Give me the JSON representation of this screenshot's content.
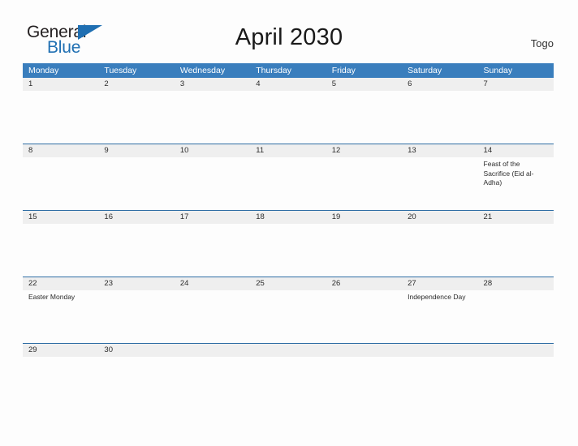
{
  "logo": {
    "word1": "General",
    "word2": "Blue",
    "triangle_color": "#1f6fb2"
  },
  "header": {
    "title": "April 2030",
    "country": "Togo"
  },
  "theme": {
    "header_blue": "#3a7ebd",
    "rule_blue": "#2e6da4",
    "date_band": "#efefef",
    "page_background": "#fdfdfd",
    "text": "#2b2b2b"
  },
  "calendar": {
    "weekdays": [
      "Monday",
      "Tuesday",
      "Wednesday",
      "Thursday",
      "Friday",
      "Saturday",
      "Sunday"
    ],
    "weeks": [
      {
        "days": [
          {
            "date": "1",
            "event": ""
          },
          {
            "date": "2",
            "event": ""
          },
          {
            "date": "3",
            "event": ""
          },
          {
            "date": "4",
            "event": ""
          },
          {
            "date": "5",
            "event": ""
          },
          {
            "date": "6",
            "event": ""
          },
          {
            "date": "7",
            "event": ""
          }
        ]
      },
      {
        "days": [
          {
            "date": "8",
            "event": ""
          },
          {
            "date": "9",
            "event": ""
          },
          {
            "date": "10",
            "event": ""
          },
          {
            "date": "11",
            "event": ""
          },
          {
            "date": "12",
            "event": ""
          },
          {
            "date": "13",
            "event": ""
          },
          {
            "date": "14",
            "event": "Feast of the Sacrifice (Eid al-Adha)"
          }
        ]
      },
      {
        "days": [
          {
            "date": "15",
            "event": ""
          },
          {
            "date": "16",
            "event": ""
          },
          {
            "date": "17",
            "event": ""
          },
          {
            "date": "18",
            "event": ""
          },
          {
            "date": "19",
            "event": ""
          },
          {
            "date": "20",
            "event": ""
          },
          {
            "date": "21",
            "event": ""
          }
        ]
      },
      {
        "days": [
          {
            "date": "22",
            "event": "Easter Monday"
          },
          {
            "date": "23",
            "event": ""
          },
          {
            "date": "24",
            "event": ""
          },
          {
            "date": "25",
            "event": ""
          },
          {
            "date": "26",
            "event": ""
          },
          {
            "date": "27",
            "event": "Independence Day"
          },
          {
            "date": "28",
            "event": ""
          }
        ]
      },
      {
        "days": [
          {
            "date": "29",
            "event": ""
          },
          {
            "date": "30",
            "event": ""
          },
          {
            "date": "",
            "event": ""
          },
          {
            "date": "",
            "event": ""
          },
          {
            "date": "",
            "event": ""
          },
          {
            "date": "",
            "event": ""
          },
          {
            "date": "",
            "event": ""
          }
        ]
      }
    ]
  }
}
